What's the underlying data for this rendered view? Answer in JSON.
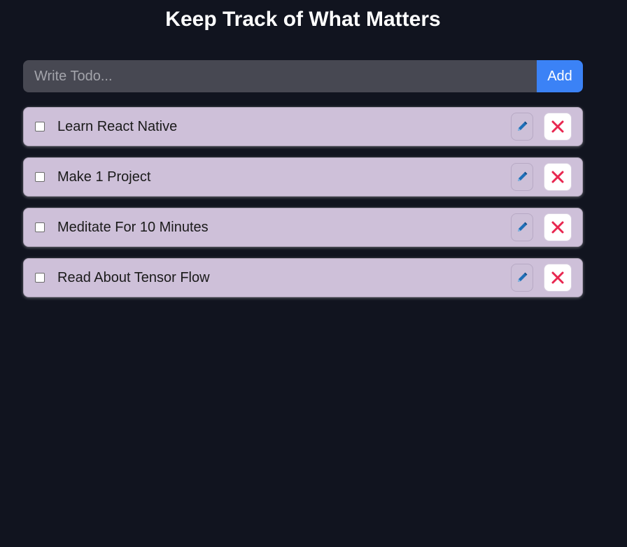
{
  "page": {
    "title": "Keep Track of What Matters"
  },
  "form": {
    "placeholder": "Write Todo...",
    "value": "",
    "add_label": "Add"
  },
  "todos": [
    {
      "text": "Learn React Native",
      "completed": false
    },
    {
      "text": "Make 1 Project",
      "completed": false
    },
    {
      "text": "Meditate For 10 Minutes",
      "completed": false
    },
    {
      "text": "Read About Tensor Flow",
      "completed": false
    }
  ],
  "icons": {
    "edit": "pencil-icon",
    "delete": "close-icon"
  },
  "colors": {
    "background": "#11141f",
    "accent": "#3b82f6",
    "item_background": "#cec0d9",
    "delete_icon": "#e8264f",
    "edit_icon": "#1e6fb8"
  }
}
